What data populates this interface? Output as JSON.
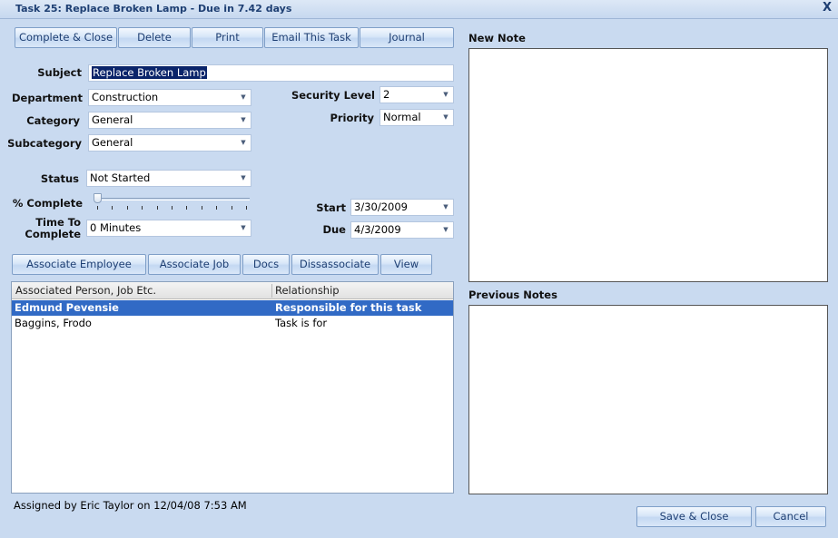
{
  "window": {
    "title": "Task 25: Replace Broken Lamp  -  Due in 7.42 days",
    "close_glyph": "X"
  },
  "toolbar": {
    "complete_close": "Complete & Close",
    "delete": "Delete",
    "print": "Print",
    "email": "Email This Task",
    "journal": "Journal"
  },
  "form": {
    "subject_label": "Subject",
    "subject_value": "Replace Broken Lamp",
    "department_label": "Department",
    "department_value": "Construction",
    "category_label": "Category",
    "category_value": "General",
    "subcategory_label": "Subcategory",
    "subcategory_value": "General",
    "security_label": "Security Level",
    "security_value": "2",
    "priority_label": "Priority",
    "priority_value": "Normal",
    "status_label": "Status",
    "status_value": "Not Started",
    "percent_label": "% Complete",
    "percent_complete": 0,
    "time_label_1": "Time To",
    "time_label_2": "Complete",
    "time_value": "0 Minutes",
    "start_label": "Start",
    "start_value": "3/30/2009",
    "due_label": "Due",
    "due_value": "4/3/2009"
  },
  "associate_buttons": {
    "employee": "Associate Employee",
    "job": "Associate Job",
    "docs": "Docs",
    "dissassociate": "Dissassociate",
    "view": "View"
  },
  "associations": {
    "columns": [
      "Associated Person, Job Etc.",
      "Relationship"
    ],
    "rows": [
      [
        "Edmund Pevensie",
        "Responsible for this task"
      ],
      [
        "Baggins, Frodo",
        "Task is for"
      ]
    ]
  },
  "footer": {
    "assigned": "Assigned by Eric Taylor on 12/04/08 7:53 AM"
  },
  "notes": {
    "new_label": "New Note",
    "previous_label": "Previous Notes"
  },
  "bottom_buttons": {
    "save_close": "Save & Close",
    "cancel": "Cancel"
  },
  "icons": {
    "dropdown": "chevron-down-icon",
    "close": "close-icon"
  },
  "colors": {
    "background": "#c9daf0",
    "title_text": "#1e3f73",
    "selection": "#316ac5"
  }
}
